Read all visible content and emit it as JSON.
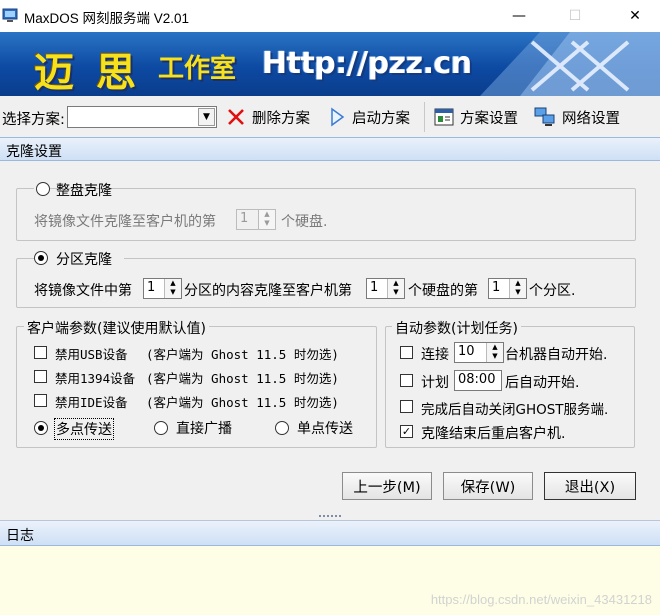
{
  "window": {
    "title": "MaxDOS 网刻服务端 V2.01",
    "minimize_glyph": "—",
    "maximize_glyph": "☐",
    "close_glyph": "✕"
  },
  "banner": {
    "logo_char_1": "迈",
    "logo_char_2": "思",
    "logo_sub": "工作室",
    "url": "Http://pzz.cn"
  },
  "toolbar": {
    "scheme_label": "选择方案:",
    "scheme_value": "",
    "delete_label": "删除方案",
    "start_label": "启动方案",
    "scheme_settings_label": "方案设置",
    "network_settings_label": "网络设置"
  },
  "clone_settings": {
    "header": "克隆设置",
    "disk_clone": {
      "label": "整盘克隆",
      "selected": false,
      "text_before": "将镜像文件克隆至客户机的第",
      "disk_number": "1",
      "text_after": "个硬盘."
    },
    "partition_clone": {
      "label": "分区克隆",
      "selected": true,
      "text_1": "将镜像文件中第",
      "source_partition": "1",
      "text_2": "分区的内容克隆至客户机第",
      "target_disk": "1",
      "text_3": "个硬盘的第",
      "target_partition": "1",
      "text_4": "个分区."
    }
  },
  "client_params": {
    "legend": "客户端参数(建议使用默认值)",
    "options": [
      {
        "label": "禁用USB设备",
        "note": "(客户端为 Ghost 11.5 时勿选)",
        "checked": false
      },
      {
        "label": "禁用1394设备",
        "note": "(客户端为 Ghost 11.5 时勿选)",
        "checked": false
      },
      {
        "label": "禁用IDE设备",
        "note": "(客户端为 Ghost 11.5 时勿选)",
        "checked": false
      }
    ],
    "transfer_modes": [
      {
        "label": "多点传送",
        "selected": true
      },
      {
        "label": "直接广播",
        "selected": false
      },
      {
        "label": "单点传送",
        "selected": false
      }
    ]
  },
  "auto_params": {
    "legend": "自动参数(计划任务)",
    "connect_label": "连接",
    "connect_count": "10",
    "connect_suffix": "台机器自动开始.",
    "schedule_label": "计划",
    "schedule_time": "08:00",
    "schedule_suffix": "后自动开始.",
    "close_ghost_label": "完成后自动关闭GHOST服务端.",
    "restart_label": "克隆结束后重启客户机.",
    "connect_checked": false,
    "schedule_checked": false,
    "close_ghost_checked": false,
    "restart_checked": true
  },
  "buttons": {
    "prev": "上一步(M)",
    "save": "保存(W)",
    "exit": "退出(X)"
  },
  "log": {
    "header": "日志",
    "watermark": "https://blog.csdn.net/weixin_43431218"
  },
  "colors": {
    "banner_blue": "#0d4aa3",
    "logo_yellow": "#f7e11b",
    "delete_red": "#e01010",
    "log_bg": "#fefee6"
  },
  "icons": {
    "delete": "red-x-icon",
    "start": "play-arrow-icon",
    "scheme_settings": "window-settings-icon",
    "network_settings": "network-computers-icon"
  }
}
